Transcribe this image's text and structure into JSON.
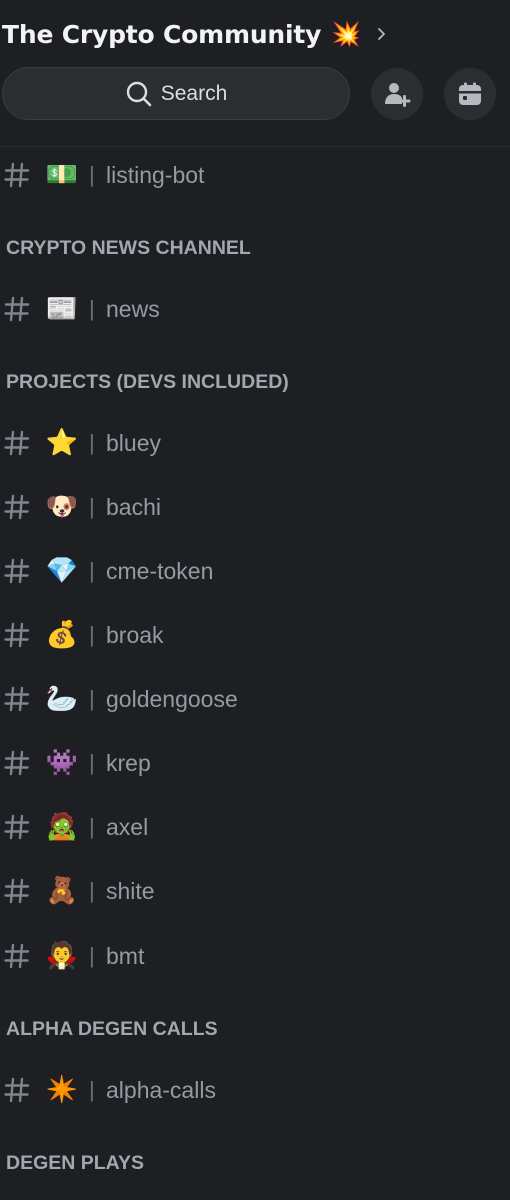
{
  "server": {
    "name": "The Crypto Community",
    "emoji": "💥"
  },
  "search": {
    "label": "Search"
  },
  "icons": {
    "invite": "add-member-icon",
    "events": "calendar-icon",
    "search": "search-icon"
  },
  "colors": {
    "background": "#1e1f22",
    "search_bg": "#2b2d31",
    "text_muted": "#949ba4",
    "text_bright": "#f2f3f5"
  },
  "channels": {
    "listing_bot": {
      "emoji": "💵",
      "name": "listing-bot"
    },
    "news": {
      "emoji": "📰",
      "name": "news"
    },
    "bluey": {
      "emoji": "⭐",
      "name": "bluey"
    },
    "bachi": {
      "emoji": "🐶",
      "name": "bachi"
    },
    "cme_token": {
      "emoji": "💎",
      "name": "cme-token"
    },
    "broak": {
      "emoji": "💰",
      "name": "broak"
    },
    "goldengoose": {
      "emoji": "🦢",
      "name": "goldengoose"
    },
    "krep": {
      "emoji": "👾",
      "name": "krep"
    },
    "axel": {
      "emoji": "🧟",
      "name": "axel"
    },
    "shite": {
      "emoji": "🧸",
      "name": "shite"
    },
    "bmt": {
      "emoji": "🧛",
      "name": "bmt"
    },
    "alpha_calls": {
      "emoji": "✴️",
      "name": "alpha-calls"
    }
  },
  "categories": {
    "crypto_news": "CRYPTO NEWS CHANNEL",
    "projects": "PROJECTS (DEVS INCLUDED)",
    "alpha": "ALPHA DEGEN CALLS",
    "degen_plays": "DEGEN PLAYS"
  },
  "separator": "|"
}
